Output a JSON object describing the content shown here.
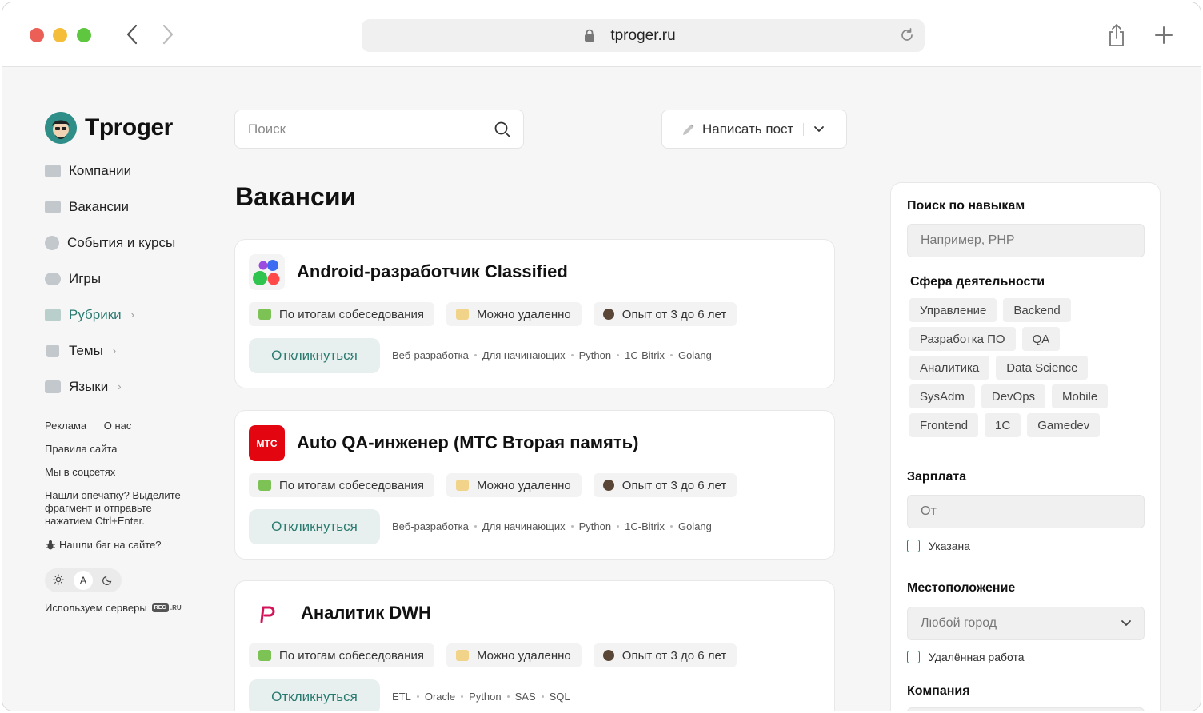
{
  "browser": {
    "url": "tproger.ru"
  },
  "sidebar": {
    "logo_text": "Tproger",
    "items": [
      {
        "label": "Компании",
        "icon": "factory-icon",
        "has_chevron": false
      },
      {
        "label": "Вакансии",
        "icon": "briefcase-icon",
        "has_chevron": false
      },
      {
        "label": "События и курсы",
        "icon": "alarm-icon",
        "has_chevron": false
      },
      {
        "label": "Игры",
        "icon": "gamepad-icon",
        "has_chevron": false
      },
      {
        "label": "Рубрики",
        "icon": "speech-bubble-icon",
        "has_chevron": true
      },
      {
        "label": "Темы",
        "icon": "document-icon",
        "has_chevron": true
      },
      {
        "label": "Языки",
        "icon": "terminal-icon",
        "has_chevron": true
      }
    ],
    "footer": {
      "ads": "Реклама",
      "about": "О нас",
      "rules": "Правила сайта",
      "social": "Мы в соцсетях",
      "typo_note": "Нашли опечатку? Выделите фрагмент и отправьте нажатием Ctrl+Enter.",
      "bug": "Нашли баг на сайте?",
      "theme_auto": "A",
      "servers": "Используем серверы",
      "regru_badge": "REG",
      "regru_suffix": ".RU"
    }
  },
  "header": {
    "search_placeholder": "Поиск",
    "write_post": "Написать пост"
  },
  "main": {
    "title": "Вакансии",
    "vacancies": [
      {
        "title": "Android-разработчик Classified",
        "logo": "dots-logo",
        "chips": [
          "По итогам собеседования",
          "Можно удаленно",
          "Опыт от 3 до 6 лет"
        ],
        "apply": "Откликнуться",
        "tags": [
          "Веб-разработка",
          "Для начинающих",
          "Python",
          "1C-Bitrix",
          "Golang"
        ]
      },
      {
        "title": "Auto QA-инженер (МТС Вторая память)",
        "logo": "mts-logo",
        "logo_text": "МТС",
        "chips": [
          "По итогам собеседования",
          "Можно удаленно",
          "Опыт от 3 до 6 лет"
        ],
        "apply": "Откликнуться",
        "tags": [
          "Веб-разработка",
          "Для начинающих",
          "Python",
          "1C-Bitrix",
          "Golang"
        ]
      },
      {
        "title": "Аналитик DWH",
        "logo": "p-logo",
        "chips": [
          "По итогам собеседования",
          "Можно удаленно",
          "Опыт от 3 до 6 лет"
        ],
        "apply": "Откликнуться",
        "tags": [
          "ETL",
          "Oracle",
          "Python",
          "SAS",
          "SQL"
        ]
      }
    ]
  },
  "filters": {
    "skills_title": "Поиск по навыкам",
    "skills_placeholder": "Например, PHP",
    "sphere_title": "Сфера деятельности",
    "spheres": [
      "Управление",
      "Backend",
      "Разработка ПО",
      "QA",
      "Аналитика",
      "Data Science",
      "SysAdm",
      "DevOps",
      "Mobile",
      "Frontend",
      "1С",
      "Gamedev"
    ],
    "salary_title": "Зарплата",
    "salary_placeholder": "От",
    "salary_specified": "Указана",
    "location_title": "Местоположение",
    "location_value": "Любой город",
    "remote": "Удалённая работа",
    "company_title": "Компания"
  },
  "colors": {
    "accent": "#2a7a70",
    "mts_red": "#e30611",
    "p_logo": "#d4145a"
  }
}
